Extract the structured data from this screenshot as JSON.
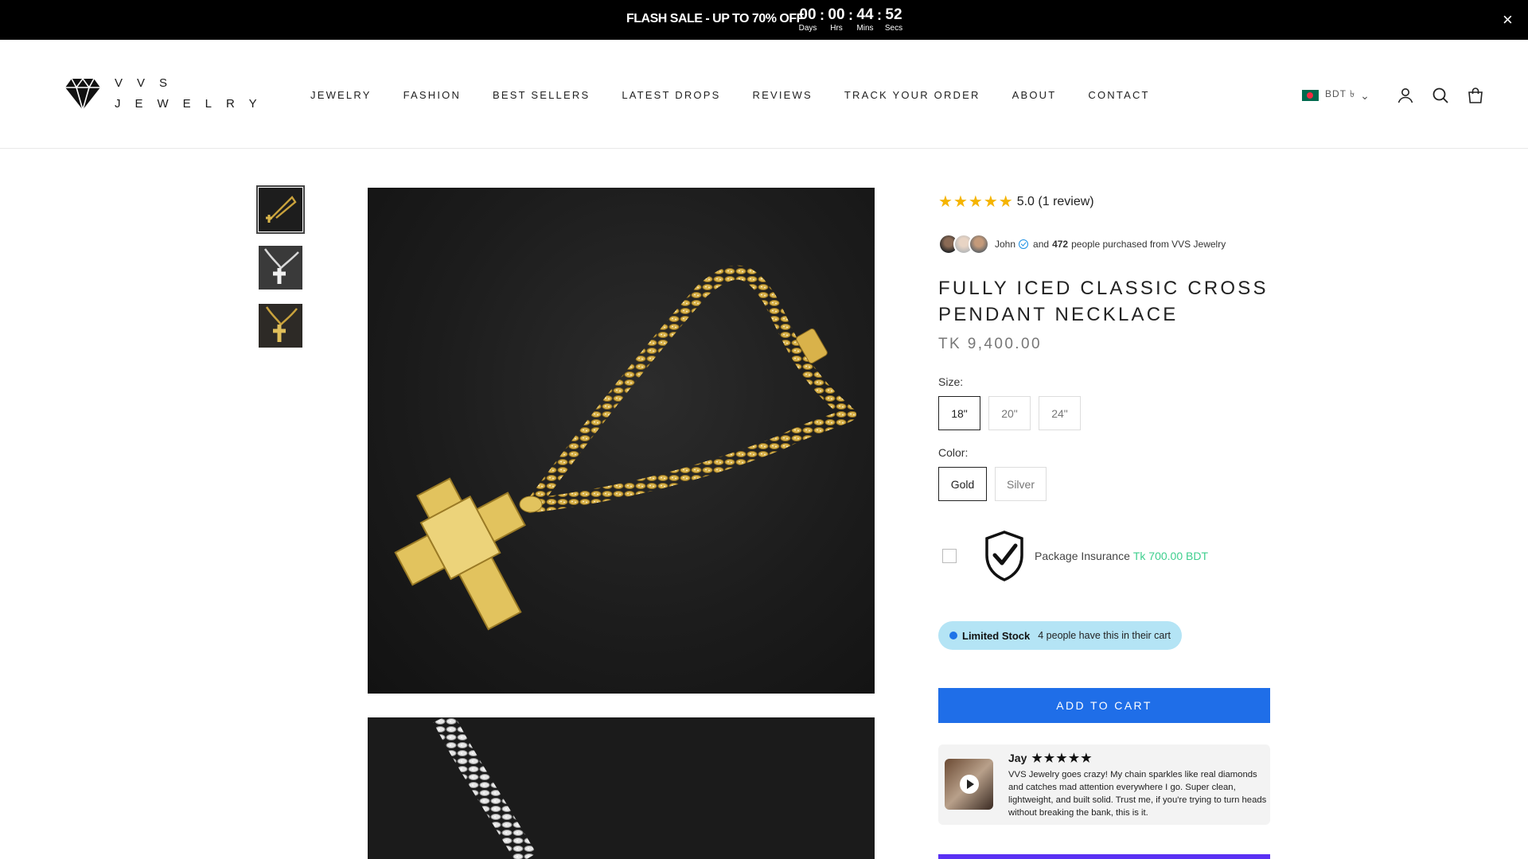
{
  "announcement": {
    "text": "FLASH SALE - UP TO 70% OFF",
    "countdown": [
      {
        "value": "00",
        "label": "Days"
      },
      {
        "value": "00",
        "label": "Hrs"
      },
      {
        "value": "44",
        "label": "Mins"
      },
      {
        "value": "52",
        "label": "Secs"
      }
    ],
    "separator": ":",
    "close_icon": "×"
  },
  "brand": {
    "line1": "VVS",
    "line2": "JEWELRY",
    "icon": "diamond-icon"
  },
  "nav": [
    "JEWELRY",
    "FASHION",
    "BEST SELLERS",
    "LATEST DROPS",
    "REVIEWS",
    "TRACK YOUR ORDER",
    "ABOUT",
    "CONTACT"
  ],
  "header_right": {
    "currency": "BDT ৳",
    "chevron": "⌄",
    "icons": [
      "account-icon",
      "search-icon",
      "cart-bag-icon"
    ]
  },
  "product": {
    "rating_value": "5.0",
    "rating_count": "(1 review)",
    "stars": 5,
    "purchased": {
      "name": "John",
      "and": "and",
      "count": "472",
      "suffix": "people purchased from VVS Jewelry"
    },
    "title": "FULLY ICED CLASSIC CROSS PENDANT NECKLACE",
    "price": "TK 9,400.00",
    "size_label": "Size:",
    "sizes": [
      "18\"",
      "20\"",
      "24\""
    ],
    "selected_size": "18\"",
    "color_label": "Color:",
    "colors": [
      "Gold",
      "Silver"
    ],
    "selected_color": "Gold",
    "insurance": {
      "label": "Package Insurance",
      "price": "Tk 700.00 BDT",
      "checked": false
    },
    "stock": {
      "label": "Limited Stock",
      "text": "4 people have this in their cart"
    },
    "add_to_cart": "ADD TO CART"
  },
  "review": {
    "author": "Jay",
    "stars": "★★★★★",
    "text": "VVS Jewelry goes crazy! My chain sparkles like real diamonds and catches mad attention everywhere I go. Super clean, lightweight, and built solid. Trust me, if you're trying to turn heads without breaking the bank, this is it."
  },
  "colors": {
    "accent": "#1f6ee8",
    "star": "#f5b400",
    "insurance_price": "#3ecf8e",
    "stock_bg": "#b4e4f5",
    "announce_bg": "#000000"
  }
}
